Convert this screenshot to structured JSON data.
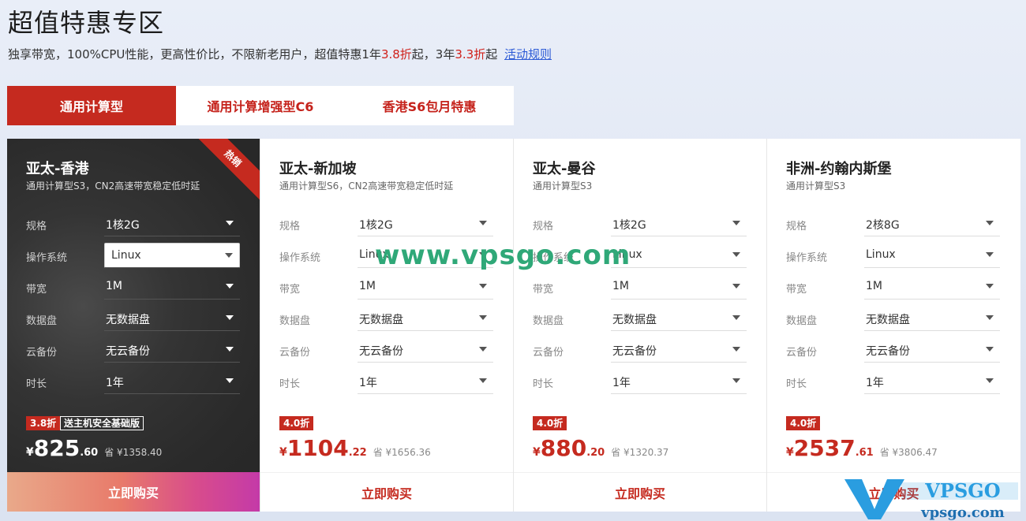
{
  "page": {
    "title": "超值特惠专区",
    "subtitle_parts": {
      "p1": "独享带宽，100%CPU性能，更高性价比，不限新老用户，超值特惠1年",
      "h1": "3.8折",
      "p2": "起，3年",
      "h2": "3.3折",
      "p3": "起",
      "link": "活动规则"
    }
  },
  "tabs": [
    {
      "label": "通用计算型",
      "active": true
    },
    {
      "label": "通用计算增强型C6",
      "active": false
    },
    {
      "label": "香港S6包月特惠",
      "active": false
    }
  ],
  "spec_labels": [
    "规格",
    "操作系统",
    "带宽",
    "数据盘",
    "云备份",
    "时长"
  ],
  "cards": [
    {
      "title": "亚太-香港",
      "desc": "通用计算型S3，CN2高速带宽稳定低时延",
      "ribbon": "热销",
      "specs": [
        "1核2G",
        "Linux",
        "1M",
        "无数据盘",
        "无云备份",
        "1年"
      ],
      "discount": "3.8折",
      "gift": "送主机安全基础版",
      "price": {
        "currency": "¥",
        "int": "825",
        "dec": ".60",
        "save": "省 ¥1358.40"
      },
      "buy": "立即购买"
    },
    {
      "title": "亚太-新加坡",
      "desc": "通用计算型S6，CN2高速带宽稳定低时延",
      "specs": [
        "1核2G",
        "Linux",
        "1M",
        "无数据盘",
        "无云备份",
        "1年"
      ],
      "discount": "4.0折",
      "price": {
        "currency": "¥",
        "int": "1104",
        "dec": ".22",
        "save": "省 ¥1656.36"
      },
      "buy": "立即购买"
    },
    {
      "title": "亚太-曼谷",
      "desc": "通用计算型S3",
      "specs": [
        "1核2G",
        "Linux",
        "1M",
        "无数据盘",
        "无云备份",
        "1年"
      ],
      "discount": "4.0折",
      "price": {
        "currency": "¥",
        "int": "880",
        "dec": ".20",
        "save": "省 ¥1320.37"
      },
      "buy": "立即购买"
    },
    {
      "title": "非洲-约翰内斯堡",
      "desc": "通用计算型S3",
      "specs": [
        "2核8G",
        "Linux",
        "1M",
        "无数据盘",
        "无云备份",
        "1年"
      ],
      "discount": "4.0折",
      "price": {
        "currency": "¥",
        "int": "2537",
        "dec": ".61",
        "save": "省 ¥3806.47"
      },
      "buy": "立即购买"
    }
  ],
  "watermark": {
    "text": "www.vpsgo.com",
    "logo_top": "VPSGO",
    "logo_bottom": "vpsgo.com"
  },
  "colors": {
    "accent": "#c52a1f",
    "watermark": "#2fa878",
    "logo_blue": "#2a9de0"
  }
}
